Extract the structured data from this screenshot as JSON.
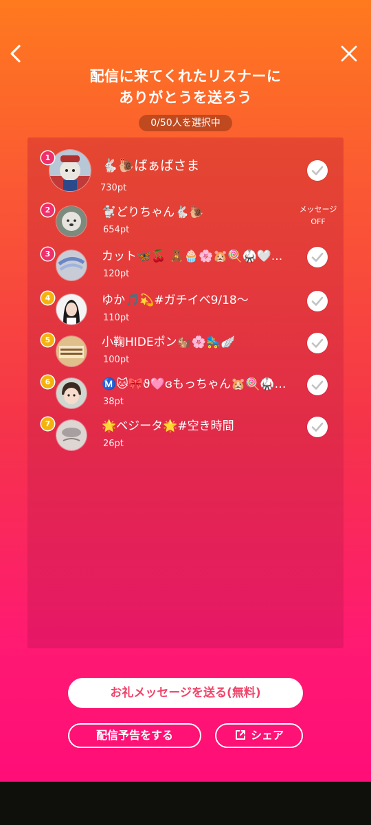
{
  "header": {
    "back_icon": "chevron-left-icon",
    "close_icon": "close-icon",
    "title_line1": "配信に来てくれたリスナーに",
    "title_line2": "ありがとうを送ろう",
    "selection_count": "0/50人を選択中"
  },
  "listeners": [
    {
      "rank": "1",
      "name": "🐇🐌ばぁばさま",
      "points": "730pt",
      "message_off": false
    },
    {
      "rank": "2",
      "name": "🐩どりちゃん🐇🐌",
      "points": "654pt",
      "message_off": true
    },
    {
      "rank": "3",
      "name": "カット🦋🍒 🧸🧁🌸🐹🍭🥋🤍...",
      "points": "120pt",
      "message_off": false
    },
    {
      "rank": "4",
      "name": "ゆか🎵💫#ガチイベ9/18〜",
      "points": "110pt",
      "message_off": false
    },
    {
      "rank": "5",
      "name": "小鞠HIDEポン🐿️🌸🛼🪽",
      "points": "100pt",
      "message_off": false
    },
    {
      "rank": "6",
      "name": "Ⓜ️🐱🎀ϑ🩷ɞもっちゃん🐹🍭🥋❄️...",
      "points": "38pt",
      "message_off": false
    },
    {
      "rank": "7",
      "name": "🌟ベジータ🌟#空き時間",
      "points": "26pt",
      "message_off": false
    }
  ],
  "message_off_label": {
    "line1": "メッセージ",
    "line2": "OFF"
  },
  "buttons": {
    "send_thanks": "お礼メッセージを送る(無料)",
    "broadcast_notice": "配信予告をする",
    "share": "シェア"
  },
  "colors": {
    "gradient_top": "#ff7a1e",
    "gradient_bottom": "#ff0d78",
    "rank_pink": "#f02f6a",
    "rank_gold": "#f5b20f",
    "primary_text": "#f0446a"
  }
}
